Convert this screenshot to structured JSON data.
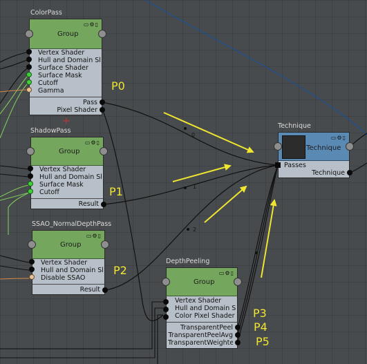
{
  "colors": {
    "background": "#474b4e",
    "node_body": "#b7c0c8",
    "group_header": "#74a65e",
    "technique_header": "#5a8ab4",
    "wire": "#111111",
    "wire_orange": "#d98a4a",
    "wire_green": "#7ec85a",
    "wire_blue": "#1f4f8f",
    "annotation": "#f0e630"
  },
  "nodes": {
    "colorpass": {
      "title": "ColorPass",
      "header_label": "Group",
      "inputs": [
        "Vertex Shader",
        "Hull and Domain Shader",
        "Surface Shader",
        "Surface Mask",
        "Cutoff",
        "Gamma"
      ],
      "input_types": [
        "black",
        "black",
        "black",
        "green",
        "green",
        "peach"
      ],
      "outputs": [
        "Pass",
        "Pixel Shader"
      ]
    },
    "shadowpass": {
      "title": "ShadowPass",
      "header_label": "Group",
      "inputs": [
        "Vertex Shader",
        "Hull and Domain Shader",
        "Surface Mask",
        "Cutoff"
      ],
      "input_types": [
        "black",
        "black",
        "green",
        "green"
      ],
      "outputs": [
        "Result"
      ]
    },
    "ssao": {
      "title": "SSAO_NormalDepthPass",
      "header_label": "Group",
      "inputs": [
        "Vertex Shader",
        "Hull and Domain Shader",
        "Disable SSAO"
      ],
      "input_types": [
        "black",
        "black",
        "peach"
      ],
      "outputs": [
        "Result"
      ]
    },
    "depthpeeling": {
      "title": "DepthPeeling",
      "header_label": "Group",
      "inputs": [
        "Vertex Shader",
        "Hull and Domain Shader",
        "Color Pixel Shader"
      ],
      "input_types": [
        "black",
        "black",
        "black"
      ],
      "outputs": [
        "TransparentPeel",
        "TransparentPeelAvg",
        "TransparentWeighted"
      ]
    },
    "technique": {
      "title": "Technique",
      "header_label": "Technique",
      "inputs": [
        "Passes"
      ],
      "outputs": [
        "Technique"
      ]
    }
  },
  "wire_labels": [
    "0",
    "1",
    "2"
  ],
  "annotations": {
    "p0": "P0",
    "p1": "P1",
    "p2": "P2",
    "p3": "P3",
    "p4": "P4",
    "p5": "P5"
  }
}
